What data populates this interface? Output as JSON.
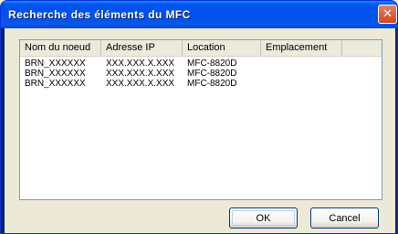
{
  "dialog": {
    "title": "Recherche des éléments du MFC",
    "close_glyph": "✕"
  },
  "list": {
    "columns": [
      "Nom du noeud",
      "Adresse IP",
      "Location",
      "Emplacement"
    ],
    "rows": [
      [
        "BRN_XXXXXX",
        "XXX.XXX.X.XXX",
        "MFC-8820D",
        ""
      ],
      [
        "BRN_XXXXXX",
        "XXX.XXX.X.XXX",
        "MFC-8820D",
        ""
      ],
      [
        "BRN_XXXXXX",
        "XXX.XXX.X.XXX",
        "MFC-8820D",
        ""
      ]
    ]
  },
  "buttons": {
    "ok": "OK",
    "cancel": "Cancel"
  }
}
